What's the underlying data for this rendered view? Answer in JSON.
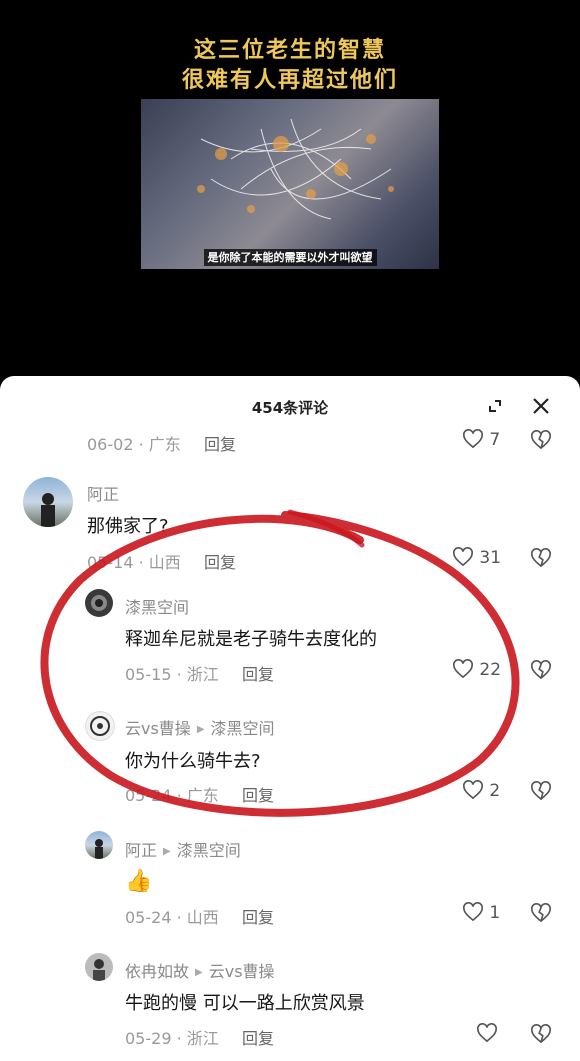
{
  "video": {
    "title_line1": "这三位老生的智慧",
    "title_line2": "很难有人再超过他们",
    "subtitle": "是你除了本能的需要以外才叫欲望"
  },
  "comments_panel": {
    "title": "454条评论"
  },
  "comments": [
    {
      "date": "06-02",
      "location": "广东",
      "reply": "回复",
      "likes": "7"
    },
    {
      "name": "阿正",
      "text": "那佛家了?",
      "date": "05-14",
      "location": "山西",
      "reply": "回复",
      "likes": "31"
    },
    {
      "name": "漆黑空间",
      "text": "释迦牟尼就是老子骑牛去度化的",
      "date": "05-15",
      "location": "浙江",
      "reply": "回复",
      "likes": "22"
    },
    {
      "name": "云vs曹操",
      "reply_to": "漆黑空间",
      "text": "你为什么骑牛去?",
      "date": "05-24",
      "location": "广东",
      "reply": "回复",
      "likes": "2"
    },
    {
      "name": "阿正",
      "reply_to": "漆黑空间",
      "text": "👍",
      "date": "05-24",
      "location": "山西",
      "reply": "回复",
      "likes": "1"
    },
    {
      "name": "依冉如故",
      "reply_to": "云vs曹操",
      "text": "牛跑的慢 可以一路上欣赏风景",
      "date": "05-29",
      "location": "浙江",
      "reply": "回复",
      "likes": ""
    }
  ],
  "colors": {
    "title_gold": "#f0c85a",
    "annotation_red": "#c8161d"
  }
}
